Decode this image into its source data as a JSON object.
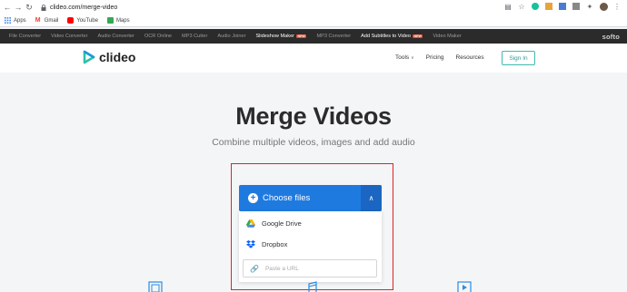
{
  "browser": {
    "url": "clideo.com/merge-video",
    "bookmarks": [
      "Apps",
      "Gmail",
      "YouTube",
      "Maps"
    ]
  },
  "softo_bar": {
    "items": [
      "File Converter",
      "Video Converter",
      "Audio Converter",
      "OCR Online",
      "MP3 Cutter",
      "Audio Joiner",
      "Slideshow Maker",
      "MP3 Converter",
      "Add Subtitles to Video",
      "Video Maker"
    ],
    "new_tag": "NEW",
    "logo": "softo"
  },
  "header": {
    "logo_text": "clideo",
    "menu": [
      "Tools",
      "Pricing",
      "Resources"
    ],
    "signin": "Sign In"
  },
  "main": {
    "title": "Merge Videos",
    "subtitle": "Combine multiple videos, images and add audio",
    "choose_files": "Choose files",
    "google_drive": "Google Drive",
    "dropbox": "Dropbox",
    "url_placeholder": "Paste a URL"
  },
  "colors": {
    "accent": "#1f7ae0",
    "highlight": "#e02222",
    "brand": "#3fb9b0"
  }
}
